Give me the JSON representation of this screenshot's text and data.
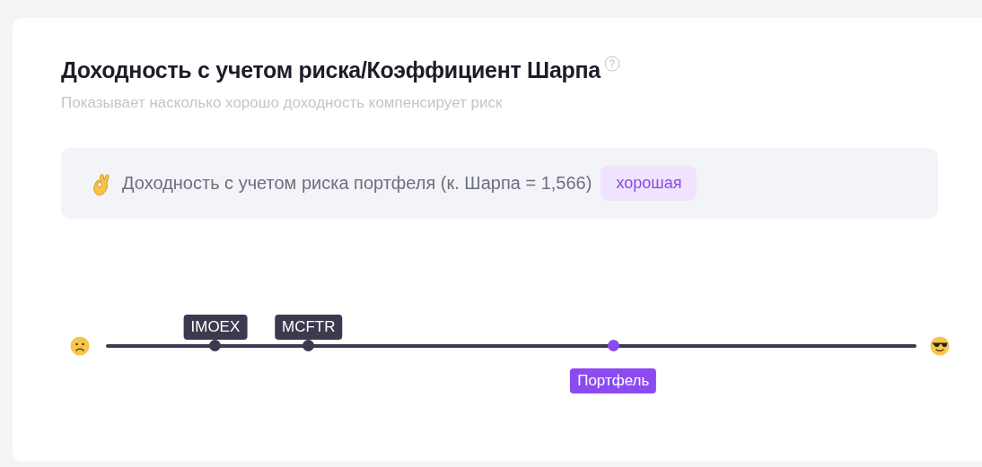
{
  "card": {
    "title": "Доходность с учетом риска/Коэффициент Шарпа",
    "subtitle": "Показывает насколько хорошо доходность компенсирует риск"
  },
  "summary": {
    "text": "Доходность с учетом риска портфеля (к. Шарпа = 1,566)",
    "badge": "хорошая"
  },
  "scale": {
    "markers": [
      {
        "label": "IMOEX",
        "kind": "benchmark",
        "level": 0.135
      },
      {
        "label": "MCFTR",
        "kind": "benchmark",
        "level": 0.25
      },
      {
        "label": "Портфель",
        "kind": "portfolio",
        "level": 0.626
      }
    ]
  }
}
